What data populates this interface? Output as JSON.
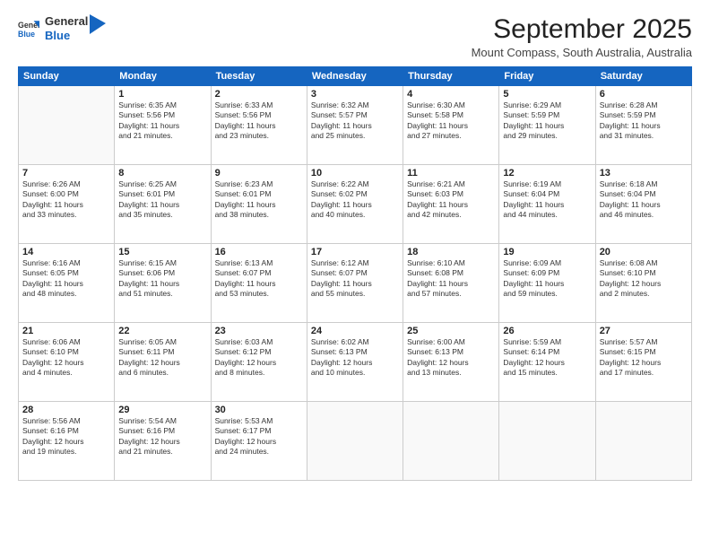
{
  "header": {
    "logo_general": "General",
    "logo_blue": "Blue",
    "month_title": "September 2025",
    "location": "Mount Compass, South Australia, Australia"
  },
  "weekdays": [
    "Sunday",
    "Monday",
    "Tuesday",
    "Wednesday",
    "Thursday",
    "Friday",
    "Saturday"
  ],
  "weeks": [
    [
      {
        "day": "",
        "info": ""
      },
      {
        "day": "1",
        "info": "Sunrise: 6:35 AM\nSunset: 5:56 PM\nDaylight: 11 hours\nand 21 minutes."
      },
      {
        "day": "2",
        "info": "Sunrise: 6:33 AM\nSunset: 5:56 PM\nDaylight: 11 hours\nand 23 minutes."
      },
      {
        "day": "3",
        "info": "Sunrise: 6:32 AM\nSunset: 5:57 PM\nDaylight: 11 hours\nand 25 minutes."
      },
      {
        "day": "4",
        "info": "Sunrise: 6:30 AM\nSunset: 5:58 PM\nDaylight: 11 hours\nand 27 minutes."
      },
      {
        "day": "5",
        "info": "Sunrise: 6:29 AM\nSunset: 5:59 PM\nDaylight: 11 hours\nand 29 minutes."
      },
      {
        "day": "6",
        "info": "Sunrise: 6:28 AM\nSunset: 5:59 PM\nDaylight: 11 hours\nand 31 minutes."
      }
    ],
    [
      {
        "day": "7",
        "info": "Sunrise: 6:26 AM\nSunset: 6:00 PM\nDaylight: 11 hours\nand 33 minutes."
      },
      {
        "day": "8",
        "info": "Sunrise: 6:25 AM\nSunset: 6:01 PM\nDaylight: 11 hours\nand 35 minutes."
      },
      {
        "day": "9",
        "info": "Sunrise: 6:23 AM\nSunset: 6:01 PM\nDaylight: 11 hours\nand 38 minutes."
      },
      {
        "day": "10",
        "info": "Sunrise: 6:22 AM\nSunset: 6:02 PM\nDaylight: 11 hours\nand 40 minutes."
      },
      {
        "day": "11",
        "info": "Sunrise: 6:21 AM\nSunset: 6:03 PM\nDaylight: 11 hours\nand 42 minutes."
      },
      {
        "day": "12",
        "info": "Sunrise: 6:19 AM\nSunset: 6:04 PM\nDaylight: 11 hours\nand 44 minutes."
      },
      {
        "day": "13",
        "info": "Sunrise: 6:18 AM\nSunset: 6:04 PM\nDaylight: 11 hours\nand 46 minutes."
      }
    ],
    [
      {
        "day": "14",
        "info": "Sunrise: 6:16 AM\nSunset: 6:05 PM\nDaylight: 11 hours\nand 48 minutes."
      },
      {
        "day": "15",
        "info": "Sunrise: 6:15 AM\nSunset: 6:06 PM\nDaylight: 11 hours\nand 51 minutes."
      },
      {
        "day": "16",
        "info": "Sunrise: 6:13 AM\nSunset: 6:07 PM\nDaylight: 11 hours\nand 53 minutes."
      },
      {
        "day": "17",
        "info": "Sunrise: 6:12 AM\nSunset: 6:07 PM\nDaylight: 11 hours\nand 55 minutes."
      },
      {
        "day": "18",
        "info": "Sunrise: 6:10 AM\nSunset: 6:08 PM\nDaylight: 11 hours\nand 57 minutes."
      },
      {
        "day": "19",
        "info": "Sunrise: 6:09 AM\nSunset: 6:09 PM\nDaylight: 11 hours\nand 59 minutes."
      },
      {
        "day": "20",
        "info": "Sunrise: 6:08 AM\nSunset: 6:10 PM\nDaylight: 12 hours\nand 2 minutes."
      }
    ],
    [
      {
        "day": "21",
        "info": "Sunrise: 6:06 AM\nSunset: 6:10 PM\nDaylight: 12 hours\nand 4 minutes."
      },
      {
        "day": "22",
        "info": "Sunrise: 6:05 AM\nSunset: 6:11 PM\nDaylight: 12 hours\nand 6 minutes."
      },
      {
        "day": "23",
        "info": "Sunrise: 6:03 AM\nSunset: 6:12 PM\nDaylight: 12 hours\nand 8 minutes."
      },
      {
        "day": "24",
        "info": "Sunrise: 6:02 AM\nSunset: 6:13 PM\nDaylight: 12 hours\nand 10 minutes."
      },
      {
        "day": "25",
        "info": "Sunrise: 6:00 AM\nSunset: 6:13 PM\nDaylight: 12 hours\nand 13 minutes."
      },
      {
        "day": "26",
        "info": "Sunrise: 5:59 AM\nSunset: 6:14 PM\nDaylight: 12 hours\nand 15 minutes."
      },
      {
        "day": "27",
        "info": "Sunrise: 5:57 AM\nSunset: 6:15 PM\nDaylight: 12 hours\nand 17 minutes."
      }
    ],
    [
      {
        "day": "28",
        "info": "Sunrise: 5:56 AM\nSunset: 6:16 PM\nDaylight: 12 hours\nand 19 minutes."
      },
      {
        "day": "29",
        "info": "Sunrise: 5:54 AM\nSunset: 6:16 PM\nDaylight: 12 hours\nand 21 minutes."
      },
      {
        "day": "30",
        "info": "Sunrise: 5:53 AM\nSunset: 6:17 PM\nDaylight: 12 hours\nand 24 minutes."
      },
      {
        "day": "",
        "info": ""
      },
      {
        "day": "",
        "info": ""
      },
      {
        "day": "",
        "info": ""
      },
      {
        "day": "",
        "info": ""
      }
    ]
  ]
}
